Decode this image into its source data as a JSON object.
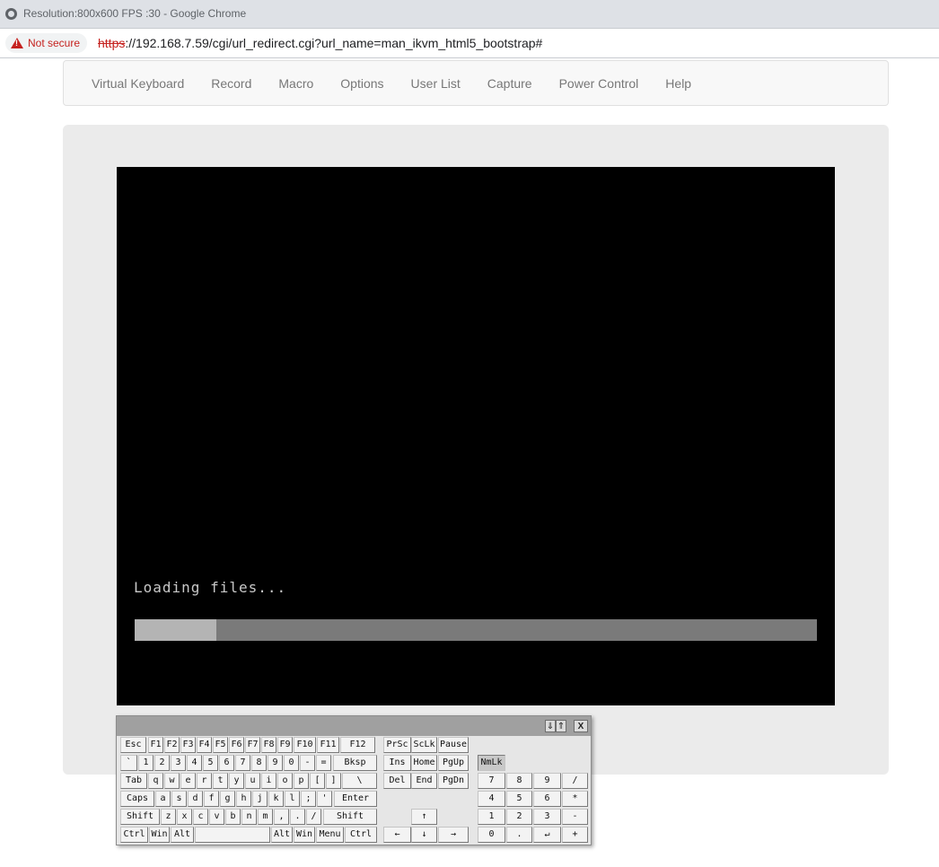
{
  "browser": {
    "window_title": "Resolution:800x600 FPS :30 - Google Chrome",
    "security_label": "Not secure",
    "url_scheme": "https",
    "url_rest": "://192.168.7.59/cgi/url_redirect.cgi?url_name=man_ikvm_html5_bootstrap#"
  },
  "nav": {
    "items": [
      "Virtual Keyboard",
      "Record",
      "Macro",
      "Options",
      "User List",
      "Capture",
      "Power Control",
      "Help"
    ]
  },
  "screen": {
    "message": "Loading files...",
    "progress_fraction": 0.12
  },
  "keyboard": {
    "header_buttons": [
      "⇓",
      "⇑",
      "X"
    ],
    "rows": [
      [
        "Esc",
        "F1",
        "F2",
        "F3",
        "F4",
        "F5",
        "F6",
        "F7",
        "F8",
        "F9",
        "F10",
        "F11",
        "F12",
        "PrSc",
        "ScLk",
        "Pause"
      ],
      [
        "`",
        "1",
        "2",
        "3",
        "4",
        "5",
        "6",
        "7",
        "8",
        "9",
        "0",
        "-",
        "=",
        "Bksp",
        "Ins",
        "Home",
        "PgUp",
        "NmLk"
      ],
      [
        "Tab",
        "q",
        "w",
        "e",
        "r",
        "t",
        "y",
        "u",
        "i",
        "o",
        "p",
        "[",
        "]",
        "\\",
        "Del",
        "End",
        "PgDn",
        "7",
        "8",
        "9",
        "/"
      ],
      [
        "Caps",
        "a",
        "s",
        "d",
        "f",
        "g",
        "h",
        "j",
        "k",
        "l",
        ";",
        "'",
        "Enter",
        "4",
        "5",
        "6",
        "*"
      ],
      [
        "Shift",
        "z",
        "x",
        "c",
        "v",
        "b",
        "n",
        "m",
        ",",
        ".",
        "/",
        "Shift",
        "↑",
        "1",
        "2",
        "3",
        "-"
      ],
      [
        "Ctrl",
        "Win",
        "Alt",
        "",
        "Alt",
        "Win",
        "Menu",
        "Ctrl",
        "←",
        "↓",
        "→",
        "0",
        ".",
        "↵",
        "+"
      ]
    ]
  }
}
